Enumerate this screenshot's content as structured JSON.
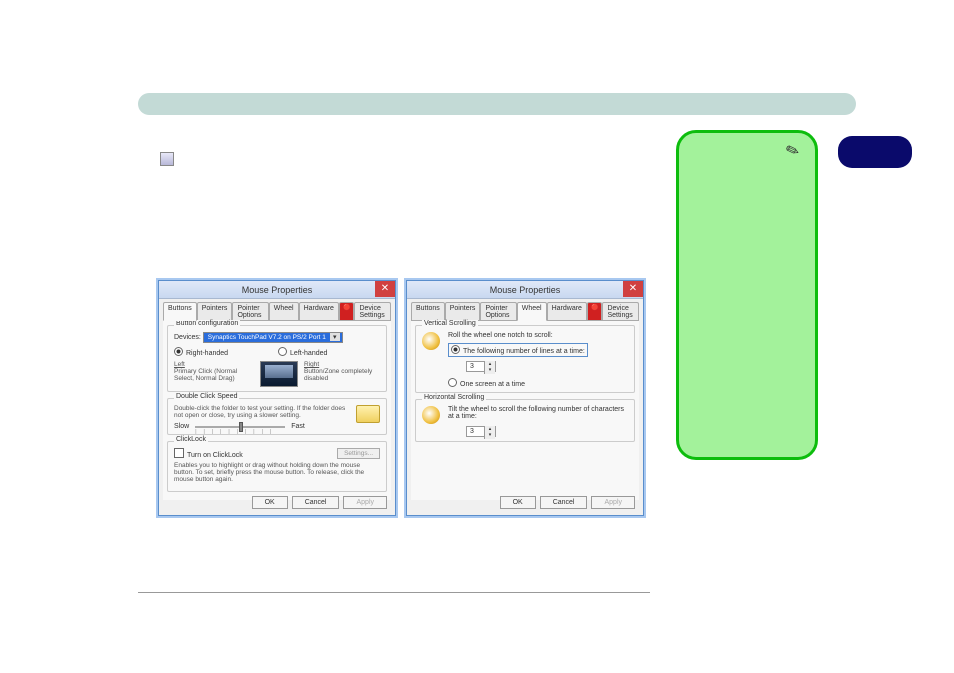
{
  "page_number_top": "",
  "page_number_bottom": "",
  "header_title": "",
  "body": {
    "line1": "",
    "line2_before_icon": "",
    "line2_after_icon": "",
    "line3": "",
    "line4": ""
  },
  "note": {
    "text": ""
  },
  "dialog_left": {
    "title": "Mouse Properties",
    "tabs": [
      "Buttons",
      "Pointers",
      "Pointer Options",
      "Wheel",
      "Hardware",
      "Device Settings"
    ],
    "active_tab": "Buttons",
    "button_config": {
      "legend": "Button configuration",
      "devices_label": "Devices:",
      "device_selected": "Synaptics TouchPad V7.2 on PS/2 Port 1",
      "right_handed": "Right-handed",
      "left_handed": "Left-handed",
      "left_col_title": "Left",
      "left_col_text": "Primary Click (Normal Select, Normal Drag)",
      "right_col_title": "Right",
      "right_col_text": "Button/Zone completely disabled"
    },
    "double_click": {
      "legend": "Double Click Speed",
      "text": "Double-click the folder to test your setting.  If the folder does not open or close, try using a slower setting.",
      "slow": "Slow",
      "fast": "Fast"
    },
    "clicklock": {
      "legend": "ClickLock",
      "checkbox": "Turn on ClickLock",
      "settings_btn": "Settings...",
      "help": "Enables you to highlight or drag without holding down the mouse button.  To set, briefly press the mouse button.  To release, click the mouse button again."
    },
    "ok": "OK",
    "cancel": "Cancel",
    "apply": "Apply"
  },
  "dialog_right": {
    "title": "Mouse Properties",
    "tabs": [
      "Buttons",
      "Pointers",
      "Pointer Options",
      "Wheel",
      "Hardware",
      "Device Settings"
    ],
    "active_tab": "Wheel",
    "vertical": {
      "legend": "Vertical Scrolling",
      "intro": "Roll the wheel one notch to scroll:",
      "opt_lines": "The following number of lines at a time:",
      "lines_value": "3",
      "opt_screen": "One screen at a time"
    },
    "horizontal": {
      "legend": "Horizontal Scrolling",
      "intro": "Tilt the wheel to scroll the following number of characters at a time:",
      "value": "3"
    },
    "ok": "OK",
    "cancel": "Cancel",
    "apply": "Apply"
  }
}
